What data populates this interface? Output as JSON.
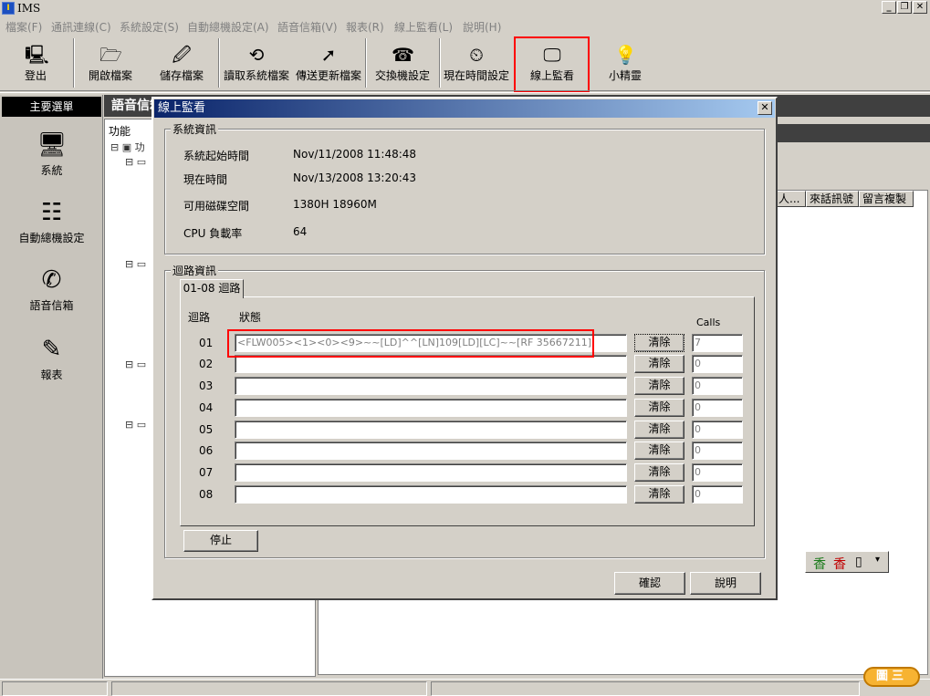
{
  "app": {
    "title": "IMS",
    "icon": "ims-logo-icon"
  },
  "menu": [
    "檔案(F)",
    "通訊連線(C)",
    "系統設定(S)",
    "自動總機設定(A)",
    "語音信箱(V)",
    "報表(R)",
    "線上監看(L)",
    "說明(H)"
  ],
  "toolbar": {
    "logout": "登出",
    "open_file": "開啟檔案",
    "save_file": "儲存檔案",
    "read_system": "讀取系統檔案",
    "send_update": "傳送更新檔案",
    "pbx_settings": "交換機設定",
    "current_time": "現在時間設定",
    "online_monitor": "線上監看",
    "wizard": "小精靈"
  },
  "left_panel": {
    "header": "主要選單",
    "items": [
      "系統",
      "自動總機設定",
      "語音信箱",
      "報表"
    ]
  },
  "background": {
    "header": "語音信箱",
    "tree_label": "功能",
    "tree_root": "功",
    "columns": [
      "人...",
      "來話訊號",
      "留言複製"
    ]
  },
  "dialog": {
    "title": "線上監看",
    "system_group": "系統資訊",
    "system_info": [
      {
        "label": "系統起始時間",
        "value": "Nov/11/2008 11:48:48"
      },
      {
        "label": "現在時間",
        "value": "Nov/13/2008 13:20:43"
      },
      {
        "label": "可用磁碟空間",
        "value": "1380H 18960M"
      },
      {
        "label": "CPU 負載率",
        "value": "64"
      }
    ],
    "loop_group": "迴路資訊",
    "tab": "01-08 迴路",
    "col_loop": "迴路",
    "col_status": "狀態",
    "col_calls": "Calls",
    "clear_label": "清除",
    "rows": [
      {
        "loop": "01",
        "status": "<FLW005><1><0><9>~~[LD]^^[LN]109[LD][LC]~~[RF 35667211]",
        "calls": "7"
      },
      {
        "loop": "02",
        "status": "",
        "calls": "0"
      },
      {
        "loop": "03",
        "status": "",
        "calls": "0"
      },
      {
        "loop": "04",
        "status": "",
        "calls": "0"
      },
      {
        "loop": "05",
        "status": "",
        "calls": "0"
      },
      {
        "loop": "06",
        "status": "",
        "calls": "0"
      },
      {
        "loop": "07",
        "status": "",
        "calls": "0"
      },
      {
        "loop": "08",
        "status": "",
        "calls": "0"
      }
    ],
    "stop": "停止",
    "ok": "確認",
    "help": "說明"
  },
  "ime": {
    "mode1": "香",
    "mode2": "香"
  },
  "figure_label": "圖三",
  "highlight_color": "#ff0000"
}
